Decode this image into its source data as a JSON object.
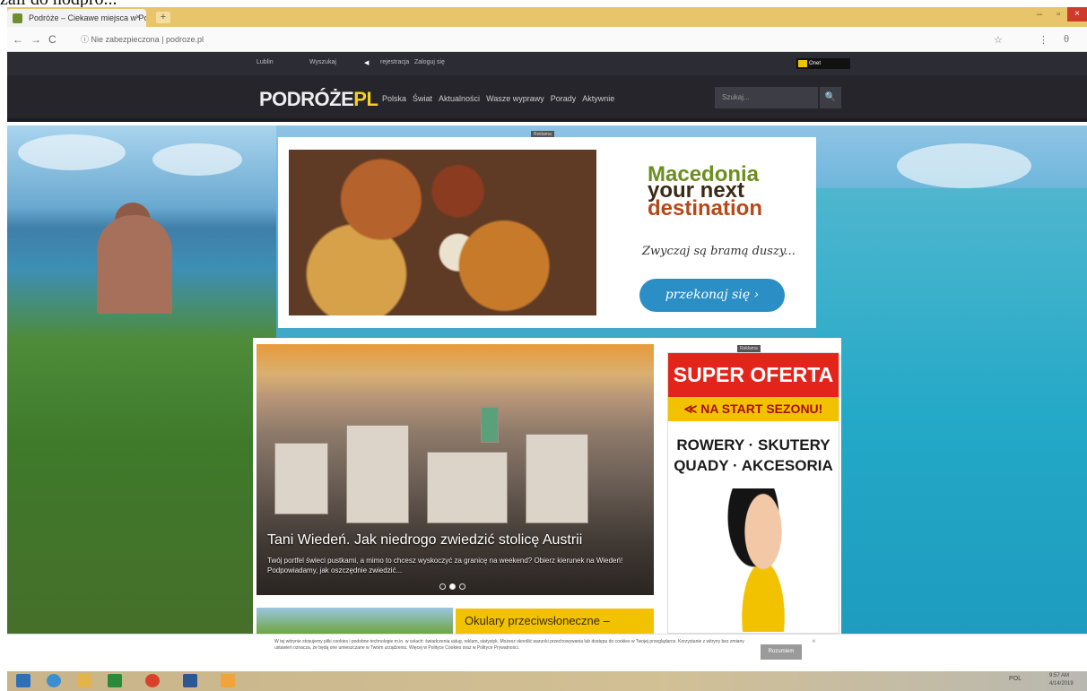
{
  "caption": "zali do nodpro...",
  "browser": {
    "tab_title": "Podróże – Ciekawe miejsca w Po...",
    "tab_close": "×",
    "new_tab": "+",
    "url_security": "Nie zabezpieczona",
    "url": "podroze.pl",
    "back_icon": "←",
    "forward_icon": "→",
    "reload_icon": "C",
    "info_icon": "ⓘ",
    "star_icon": "☆",
    "menu_icon": "⋮",
    "profile_icon": "θ",
    "win_min": "–",
    "win_max": "▫",
    "win_close": "×"
  },
  "site": {
    "top_links": [
      "Lublin",
      "Wyszukaj",
      "rejestracja",
      "Zaloguj się"
    ],
    "weather_badge": "Onet",
    "logo_main": "PODRÓŻE",
    "logo_suffix": "PL",
    "menu": [
      "Polska",
      "Świat",
      "Aktualności",
      "Wasze wyprawy",
      "Porady",
      "Aktywnie"
    ],
    "search_placeholder": "Szukaj...",
    "search_icon": "🔍"
  },
  "ad_banner": {
    "tag": "Reklama",
    "title_line1": "Macedonia",
    "title_line2": "your next",
    "title_line3": "destination",
    "tagline": "Zwyczaj są bramą duszy...",
    "button": "przekonaj się ›"
  },
  "article": {
    "title": "Tani Wiedeń. Jak niedrogo zwiedzić stolicę Austrii",
    "description": "Twój portfel świeci pustkami, a mimo to chcesz wyskoczyć za granicę na weekend? Obierz kierunek na Wiedeń! Podpowiadamy, jak oszczędnie zwiedzić...",
    "slides": 3,
    "active_slide": 2,
    "teaser": "Okulary przeciwsłoneczne –"
  },
  "side_ad": {
    "tag": "Reklama",
    "headline": "SUPER OFERTA",
    "subhead": "NA START SEZONU!",
    "line1": "ROWERY · SKUTERY",
    "line2": "QUADY · AKCESORIA"
  },
  "cookie": {
    "text": "W tej witrynie stosujemy pliki cookies i podobne technologie m.in. w celach: świadczenia usług, reklam, statystyk. Możesz określić warunki przechowywania lub dostępu do cookies w Twojej przeglądarce. Korzystanie z witryny bez zmiany ustawień oznacza, że będą one umieszczane w Twoim urządzeniu. Więcej w Polityce Cookies oraz w Polityce Prywatności.",
    "button": "Rozumiem",
    "close": "×"
  },
  "taskbar": {
    "tray_text": "POL",
    "time": "9:57 AM",
    "date": "4/14/2019"
  },
  "colors": {
    "tab_strip": "#e8c46a",
    "site_dark": "#25252b",
    "logo_accent": "#f3d11c",
    "ad_red": "#e3241b",
    "ad_yellow": "#f2c200",
    "button_blue": "#2b8fc6"
  }
}
